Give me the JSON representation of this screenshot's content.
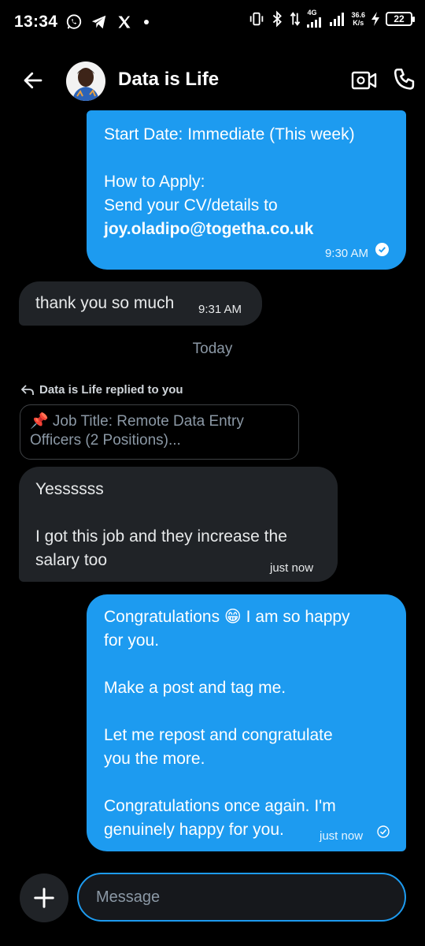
{
  "status_bar": {
    "time": "13:34",
    "net_speed_value": "36.6",
    "net_speed_unit": "K/s",
    "network_type": "4G",
    "battery": "22"
  },
  "header": {
    "title": "Data is Life"
  },
  "messages": {
    "m1": {
      "line1": "Start Date: Immediate (This week)",
      "line2": "How to Apply:",
      "line3": "Send your CV/details to",
      "email": "joy.oladipo@togetha.co.uk",
      "time": "9:30 AM"
    },
    "m2": {
      "text": "thank you so much",
      "time": "9:31 AM"
    },
    "day_separator": "Today",
    "reply": {
      "context": "Data is Life replied to you",
      "quoted_line1": "📌 Job Title: Remote Data Entry",
      "quoted_line2": "Officers (2 Positions)..."
    },
    "m3": {
      "line1": "Yessssss",
      "line2": "I got this job and they increase the",
      "line3": "salary too",
      "time": "just now"
    },
    "m4": {
      "line1": "Congratulations 😁 I am so happy",
      "line2": "for you.",
      "line3": "Make a post and tag me.",
      "line4": "Let me repost and congratulate",
      "line5": "you the more.",
      "line6": "Congratulations once again. I'm",
      "line7": "genuinely happy for you.",
      "time": "just now"
    }
  },
  "composer": {
    "placeholder": "Message"
  },
  "colors": {
    "accent": "#1d9bf0",
    "incoming_bubble": "#202327",
    "background": "#000000"
  }
}
